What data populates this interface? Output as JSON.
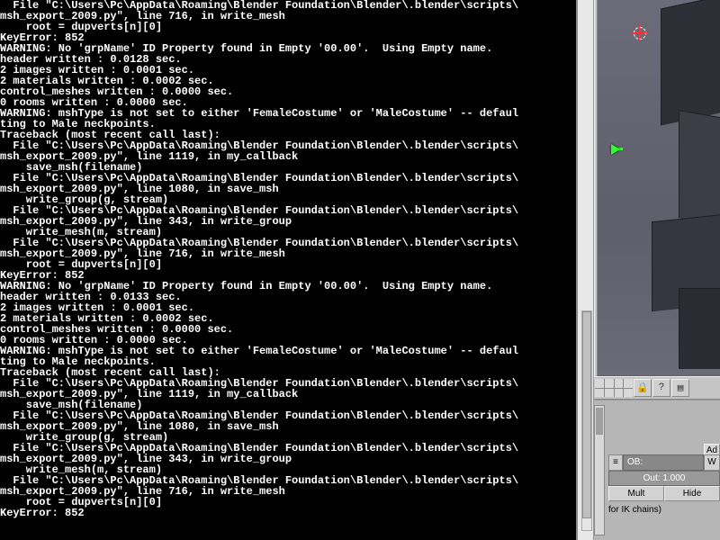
{
  "console": {
    "lines": [
      "  File \"C:\\Users\\Pc\\AppData\\Roaming\\Blender Foundation\\Blender\\.blender\\scripts\\",
      "msh_export_2009.py\", line 716, in write_mesh",
      "    root = dupverts[n][0]",
      "KeyError: 852",
      "WARNING: No 'grpName' ID Property found in Empty '00.00'.  Using Empty name.",
      "header written : 0.0128 sec.",
      "2 images written : 0.0001 sec.",
      "2 materials written : 0.0002 sec.",
      "control_meshes written : 0.0000 sec.",
      "0 rooms written : 0.0000 sec.",
      "WARNING: mshType is not set to either 'FemaleCostume' or 'MaleCostume' -- defaul",
      "ting to Male neckpoints.",
      "Traceback (most recent call last):",
      "  File \"C:\\Users\\Pc\\AppData\\Roaming\\Blender Foundation\\Blender\\.blender\\scripts\\",
      "msh_export_2009.py\", line 1119, in my_callback",
      "    save_msh(filename)",
      "  File \"C:\\Users\\Pc\\AppData\\Roaming\\Blender Foundation\\Blender\\.blender\\scripts\\",
      "msh_export_2009.py\", line 1080, in save_msh",
      "    write_group(g, stream)",
      "  File \"C:\\Users\\Pc\\AppData\\Roaming\\Blender Foundation\\Blender\\.blender\\scripts\\",
      "msh_export_2009.py\", line 343, in write_group",
      "    write_mesh(m, stream)",
      "  File \"C:\\Users\\Pc\\AppData\\Roaming\\Blender Foundation\\Blender\\.blender\\scripts\\",
      "msh_export_2009.py\", line 716, in write_mesh",
      "    root = dupverts[n][0]",
      "KeyError: 852",
      "WARNING: No 'grpName' ID Property found in Empty '00.00'.  Using Empty name.",
      "header written : 0.0133 sec.",
      "2 images written : 0.0001 sec.",
      "2 materials written : 0.0002 sec.",
      "control_meshes written : 0.0000 sec.",
      "0 rooms written : 0.0000 sec.",
      "WARNING: mshType is not set to either 'FemaleCostume' or 'MaleCostume' -- defaul",
      "ting to Male neckpoints.",
      "Traceback (most recent call last):",
      "  File \"C:\\Users\\Pc\\AppData\\Roaming\\Blender Foundation\\Blender\\.blender\\scripts\\",
      "msh_export_2009.py\", line 1119, in my_callback",
      "    save_msh(filename)",
      "  File \"C:\\Users\\Pc\\AppData\\Roaming\\Blender Foundation\\Blender\\.blender\\scripts\\",
      "msh_export_2009.py\", line 1080, in save_msh",
      "    write_group(g, stream)",
      "  File \"C:\\Users\\Pc\\AppData\\Roaming\\Blender Foundation\\Blender\\.blender\\scripts\\",
      "msh_export_2009.py\", line 343, in write_group",
      "    write_mesh(m, stream)",
      "  File \"C:\\Users\\Pc\\AppData\\Roaming\\Blender Foundation\\Blender\\.blender\\scripts\\",
      "msh_export_2009.py\", line 716, in write_mesh",
      "    root = dupverts[n][0]",
      "KeyError: 852"
    ]
  },
  "toolbar": {
    "lock_glyph": "🔒",
    "help_glyph": "?",
    "script_glyph": "▤"
  },
  "panel": {
    "add_label": "Ad",
    "menu_glyph": "≡",
    "ob_label": "OB:",
    "w_label": "W",
    "out_label": "Out: 1.000",
    "mult_label": "Mult",
    "hide_label": "Hide",
    "desc_text": "for IK chains)"
  }
}
